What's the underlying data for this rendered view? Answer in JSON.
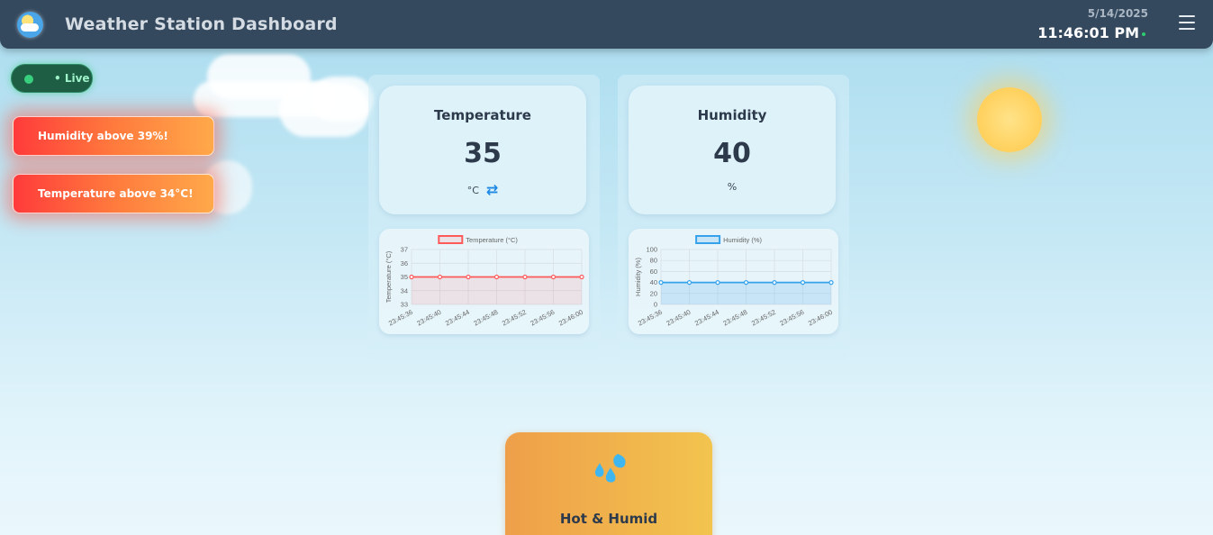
{
  "header": {
    "title": "Weather Station Dashboard",
    "date": "5/14/2025",
    "time": "11:46:01 PM"
  },
  "live_badge": {
    "label": "• Live"
  },
  "alerts": [
    {
      "text": "Humidity above 39%!"
    },
    {
      "text": "Temperature above 34°C!"
    }
  ],
  "temperature": {
    "title": "Temperature",
    "value": "35",
    "unit": "°C"
  },
  "humidity": {
    "title": "Humidity",
    "value": "40",
    "unit": "%"
  },
  "status": {
    "label": "Hot & Humid",
    "icon": "water-drops-icon"
  },
  "colors": {
    "temperature": "#ff5a5a",
    "humidity": "#36a2eb",
    "header": "#34495e"
  },
  "chart_data": [
    {
      "type": "line",
      "legend": "Temperature (°C)",
      "ylabel": "Temperature (°C)",
      "x": [
        "23:45:36",
        "23:45:40",
        "23:45:44",
        "23:45:48",
        "23:45:52",
        "23:45:56",
        "23:46:00"
      ],
      "values": [
        35,
        35,
        35,
        35,
        35,
        35,
        35
      ],
      "ylim": [
        33,
        37
      ],
      "yticks": [
        "37",
        "36",
        "35",
        "34",
        "33"
      ],
      "grid": true,
      "legend_position": "top"
    },
    {
      "type": "area",
      "legend": "Humidity (%)",
      "ylabel": "Humidity (%)",
      "x": [
        "23:45:36",
        "23:45:40",
        "23:45:44",
        "23:45:48",
        "23:45:52",
        "23:45:56",
        "23:46:00"
      ],
      "values": [
        40,
        40,
        40,
        40,
        40,
        40,
        40
      ],
      "ylim": [
        0,
        100
      ],
      "yticks": [
        "100",
        "80",
        "60",
        "40",
        "20",
        "0"
      ],
      "grid": true,
      "legend_position": "top"
    }
  ]
}
